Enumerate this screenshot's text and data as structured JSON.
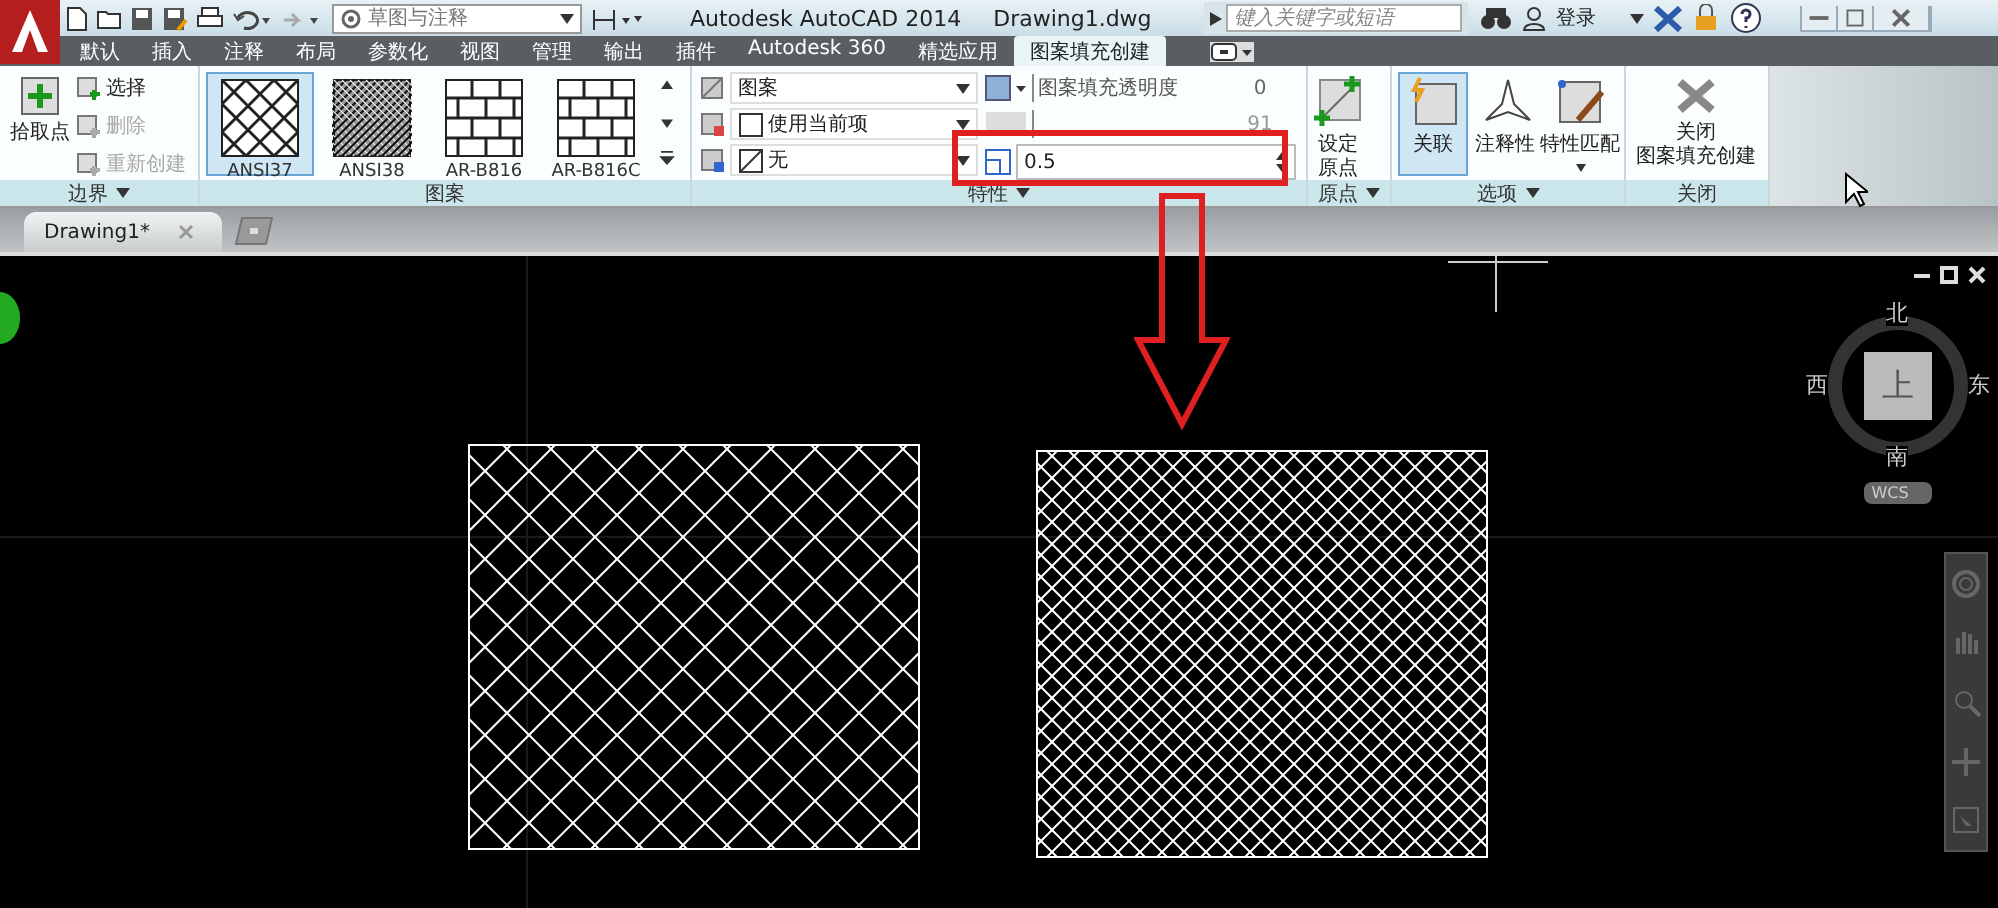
{
  "title_bar": {
    "workspace": "草图与注释",
    "title": "Autodesk AutoCAD 2014",
    "document": "Drawing1.dwg",
    "search": {
      "placeholder": "键入关键字或短语"
    },
    "login": "登录"
  },
  "ribbon_tabs": [
    {
      "label": "默认",
      "selected": false
    },
    {
      "label": "插入",
      "selected": false
    },
    {
      "label": "注释",
      "selected": false
    },
    {
      "label": "布局",
      "selected": false
    },
    {
      "label": "参数化",
      "selected": false
    },
    {
      "label": "视图",
      "selected": false
    },
    {
      "label": "管理",
      "selected": false
    },
    {
      "label": "输出",
      "selected": false
    },
    {
      "label": "插件",
      "selected": false
    },
    {
      "label": "Autodesk 360",
      "selected": false
    },
    {
      "label": "精选应用",
      "selected": false
    },
    {
      "label": "图案填充创建",
      "selected": true
    }
  ],
  "boundary_panel": {
    "label": "边界",
    "pick": "拾取点",
    "items": [
      {
        "label": "选择",
        "disabled": false
      },
      {
        "label": "删除",
        "disabled": true
      },
      {
        "label": "重新创建",
        "disabled": true
      }
    ]
  },
  "pattern_panel": {
    "label": "图案",
    "patterns": [
      {
        "name": "ANSI37",
        "kind": "cross",
        "selected": true
      },
      {
        "name": "ANSI38",
        "kind": "dense",
        "selected": false
      },
      {
        "name": "AR-B816",
        "kind": "brick",
        "selected": false
      },
      {
        "name": "AR-B816C",
        "kind": "brick",
        "selected": false
      }
    ]
  },
  "properties_panel": {
    "label": "特性",
    "dropdowns": [
      "图案",
      "使用当前项",
      "无"
    ],
    "transparency": {
      "label": "图案填充透明度",
      "value": "0"
    },
    "angle": {
      "value": "91"
    },
    "scale": {
      "value": "0.5"
    }
  },
  "origin_panel": {
    "label": "原点",
    "button": [
      "设定",
      "原点"
    ]
  },
  "options_panel": {
    "label": "选项",
    "buttons": [
      {
        "label": "关联",
        "selected": true
      },
      {
        "label": "注释性",
        "selected": false
      },
      {
        "label": "特性匹配",
        "selected": false
      }
    ]
  },
  "close_panel": {
    "label": "关闭",
    "button": [
      "关闭",
      "图案填充创建"
    ]
  },
  "document_tabs": [
    {
      "label": "Drawing1*",
      "selected": true
    }
  ],
  "viewcube": {
    "north": "北",
    "west": "西",
    "face": "上",
    "east": "东",
    "south": "南",
    "ucs": "WCS"
  }
}
